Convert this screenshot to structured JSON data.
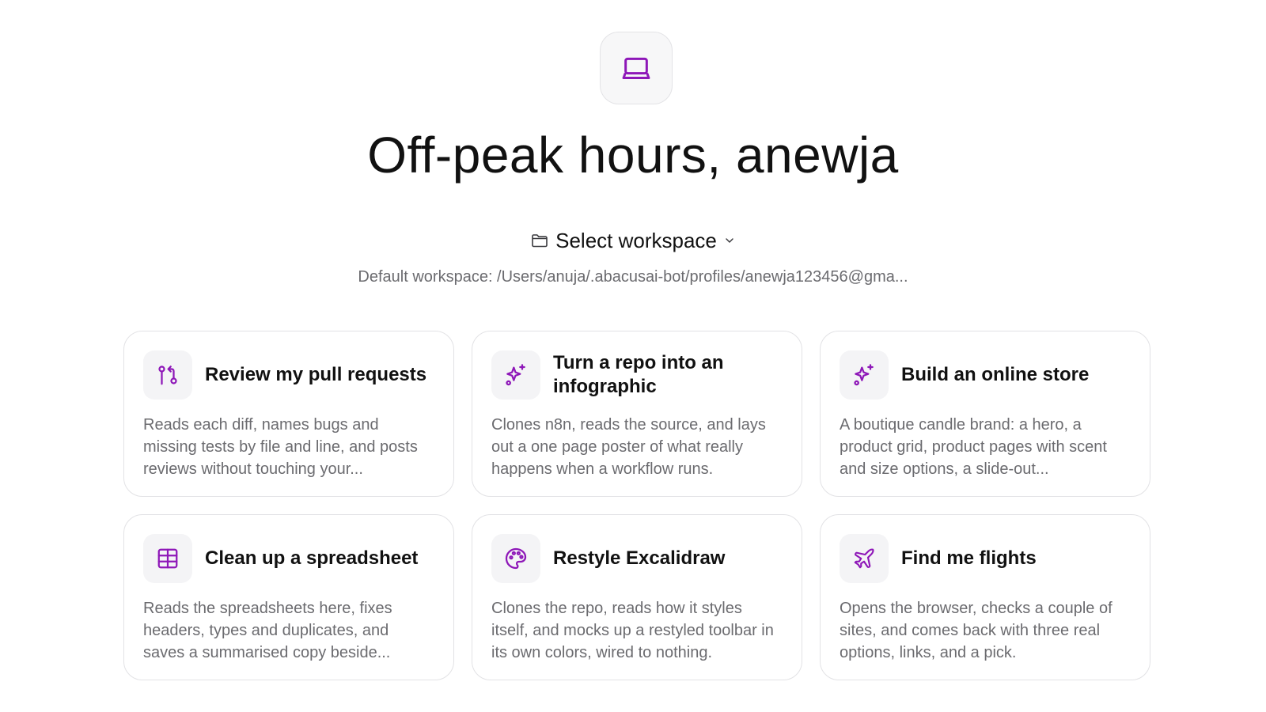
{
  "header": {
    "app_icon": "laptop-icon",
    "greeting": "Off-peak hours, anewja"
  },
  "workspace": {
    "select_label": "Select workspace",
    "folder_icon": "folder-icon",
    "chevron_icon": "chevron-down-icon",
    "default_path": "Default workspace: /Users/anuja/.abacusai-bot/profiles/anewja123456@gma..."
  },
  "accent_color": "#8e17b8",
  "cards": [
    {
      "icon": "git-pull-request-icon",
      "title": "Review my pull requests",
      "description": "Reads each diff, names bugs and missing tests by file and line, and posts reviews without touching your..."
    },
    {
      "icon": "sparkles-icon",
      "title": "Turn a repo into an infographic",
      "description": "Clones n8n, reads the source, and lays out a one page poster of what really happens when a workflow runs."
    },
    {
      "icon": "sparkles-icon",
      "title": "Build an online store",
      "description": "A boutique candle brand: a hero, a product grid, product pages with scent and size options, a slide-out..."
    },
    {
      "icon": "table-icon",
      "title": "Clean up a spreadsheet",
      "description": "Reads the spreadsheets here, fixes headers, types and duplicates, and saves a summarised copy beside..."
    },
    {
      "icon": "palette-icon",
      "title": "Restyle Excalidraw",
      "description": "Clones the repo, reads how it styles itself, and mocks up a restyled toolbar in its own colors, wired to nothing."
    },
    {
      "icon": "plane-icon",
      "title": "Find me flights",
      "description": "Opens the browser, checks a couple of sites, and comes back with three real options, links, and a pick."
    }
  ]
}
